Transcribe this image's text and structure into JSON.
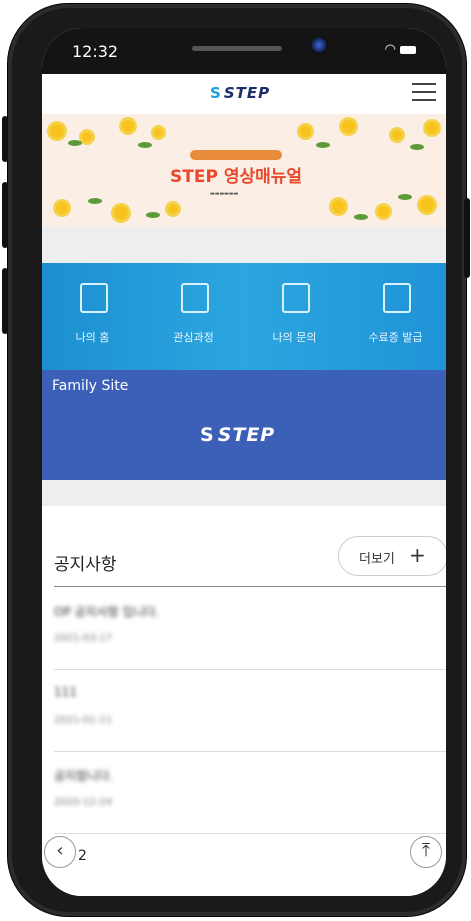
{
  "status_bar": {
    "time": "12:32"
  },
  "header": {
    "logo_text": "STEP",
    "logo_mark": "S"
  },
  "banner": {
    "title": "STEP 영상매뉴얼"
  },
  "quick_menu": [
    {
      "label": "나의 홈",
      "icon": "monitor-user-icon"
    },
    {
      "label": "관심과정",
      "icon": "bookmark-heart-icon"
    },
    {
      "label": "나의 문의",
      "icon": "search-document-icon"
    },
    {
      "label": "수료증 발급",
      "icon": "certificate-icon"
    }
  ],
  "family_site": {
    "title": "Family Site",
    "logo_text": "STEP",
    "logo_mark": "S"
  },
  "notice": {
    "title": "공지사항",
    "more_label": "더보기",
    "more_icon": "+",
    "items": [
      {
        "title": "OP 공지사항 입니다.",
        "date": "2021-03-17"
      },
      {
        "title": "111",
        "date": "2021-01-11"
      },
      {
        "title": "공지합니다.",
        "date": "2020-12-24"
      }
    ],
    "next_label": "2"
  },
  "nav": {
    "back_icon": "‹",
    "top_icon": "⤒"
  },
  "colors": {
    "menu_bg": "#2ba6e0",
    "family_bg": "#3c5fb8",
    "logo": "#1b2d6b",
    "banner_title": "#e8492c"
  }
}
